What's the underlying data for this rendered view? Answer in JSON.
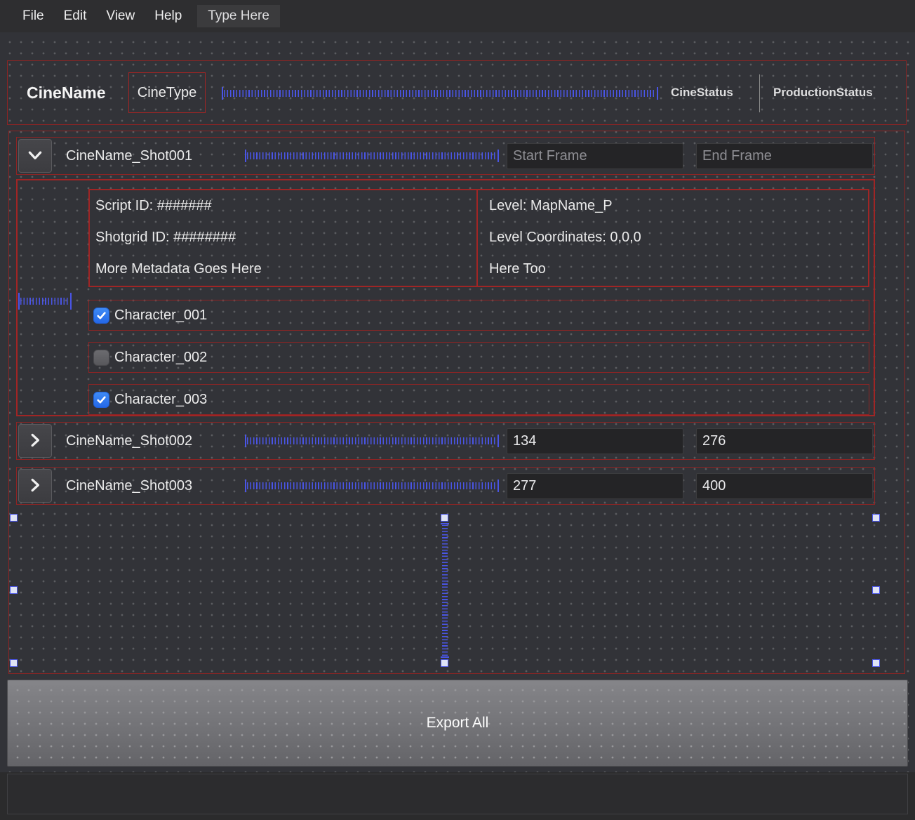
{
  "menu": {
    "items": [
      {
        "label": "File"
      },
      {
        "label": "Edit"
      },
      {
        "label": "View"
      },
      {
        "label": "Help"
      }
    ],
    "type_here": "Type Here"
  },
  "header": {
    "cine_name": "CineName",
    "cine_type": "CineType",
    "cine_status": "CineStatus",
    "production_status": "ProductionStatus"
  },
  "shots": [
    {
      "name": "CineName_Shot001",
      "expanded": true,
      "start_frame": "",
      "end_frame": "",
      "start_placeholder": "Start Frame",
      "end_placeholder": "End Frame"
    },
    {
      "name": "CineName_Shot002",
      "expanded": false,
      "start_frame": "134",
      "end_frame": "276"
    },
    {
      "name": "CineName_Shot003",
      "expanded": false,
      "start_frame": "277",
      "end_frame": "400"
    }
  ],
  "details": {
    "metadata_left": [
      "Script ID: #######",
      "Shotgrid ID: ########",
      "More Metadata Goes Here"
    ],
    "metadata_right": [
      "Level: MapName_P",
      "Level Coordinates: 0,0,0",
      "Here Too"
    ],
    "characters": [
      {
        "label": "Character_001",
        "checked": true
      },
      {
        "label": "Character_002",
        "checked": false
      },
      {
        "label": "Character_003",
        "checked": true
      }
    ]
  },
  "footer": {
    "export_all": "Export All"
  },
  "colors": {
    "layout_outline_red": "#a02525",
    "spacer_blue": "#4a55e6",
    "checkbox_blue": "#2f7cf6",
    "canvas_bg": "#323338"
  }
}
